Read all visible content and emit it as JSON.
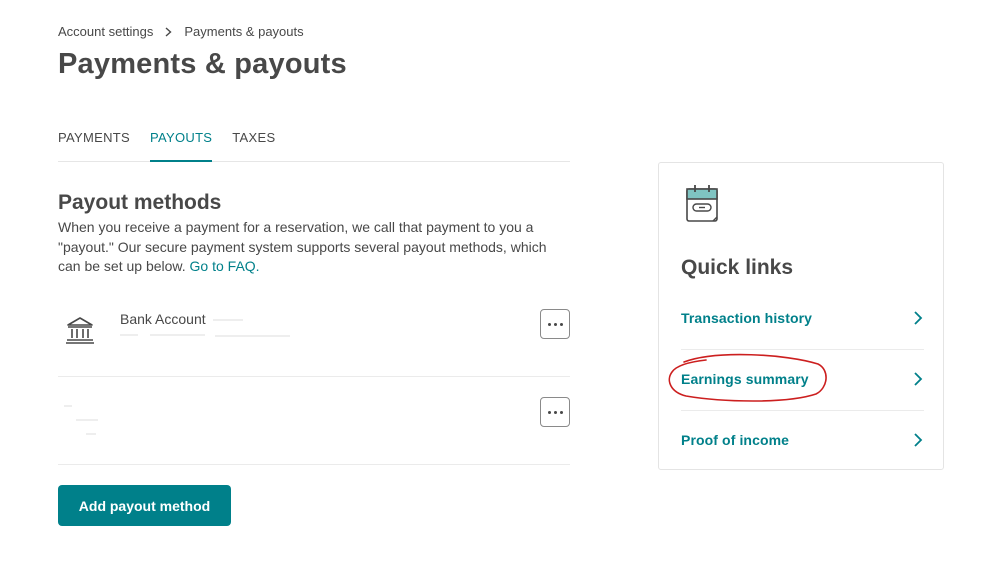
{
  "breadcrumb": {
    "parent": "Account settings",
    "current": "Payments & payouts",
    "separator_icon": "chevron-right-icon"
  },
  "page": {
    "title": "Payments & payouts"
  },
  "tabs": [
    {
      "label": "PAYMENTS",
      "active": false
    },
    {
      "label": "PAYOUTS",
      "active": true
    },
    {
      "label": "TAXES",
      "active": false
    }
  ],
  "payout_methods": {
    "title": "Payout methods",
    "description": "When you receive a payment for a reservation, we call that payment to you a \"payout.\" Our secure payment system supports several payout methods, which can be set up below. ",
    "faq_link": "Go to FAQ.",
    "methods": [
      {
        "label": "Bank Account",
        "icon": "bank-icon"
      },
      {
        "label": "",
        "icon": ""
      }
    ],
    "add_button": "Add payout method"
  },
  "quick_links": {
    "icon": "calendar-icon",
    "title": "Quick links",
    "items": [
      {
        "label": "Transaction history"
      },
      {
        "label": "Earnings summary"
      },
      {
        "label": "Proof of income"
      }
    ]
  },
  "colors": {
    "accent": "#00808a",
    "text": "#484848",
    "annotation": "#cc1f1f"
  }
}
